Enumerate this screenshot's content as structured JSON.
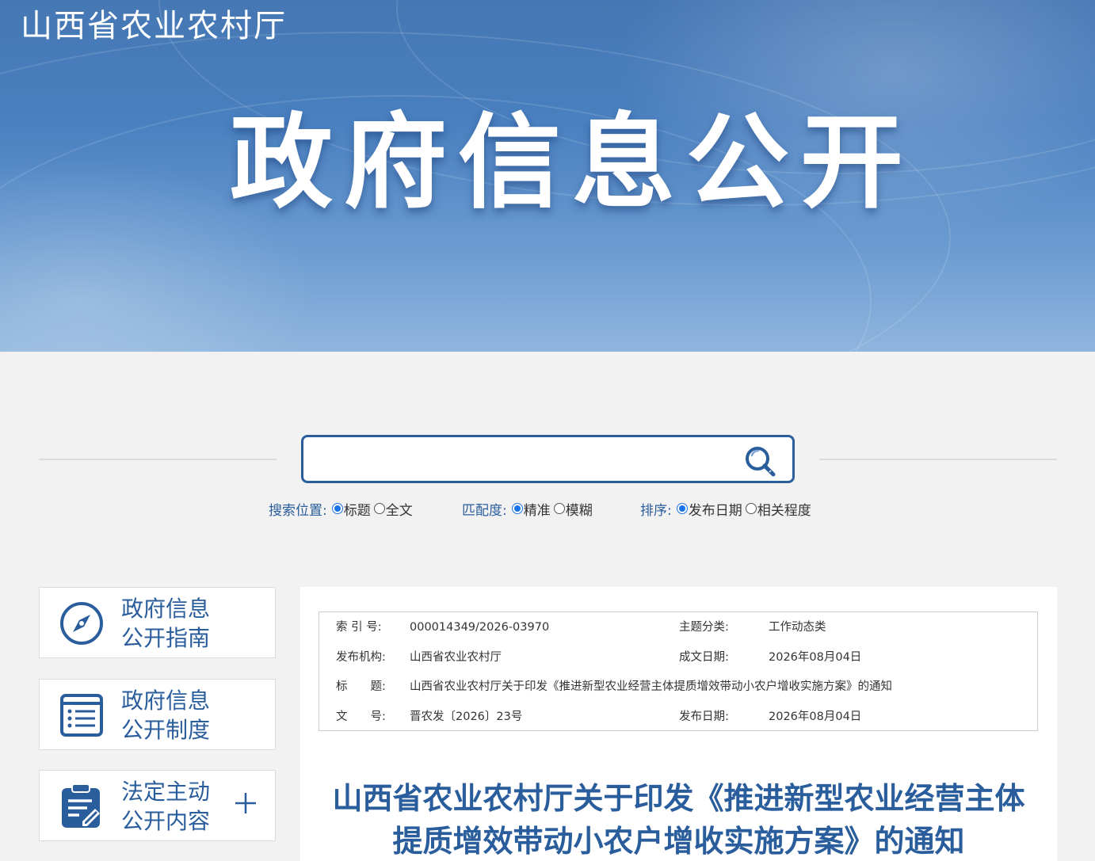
{
  "header": {
    "org_name": "山西省农业农村厅",
    "headline": "政府信息公开"
  },
  "search": {
    "placeholder": "",
    "value": "",
    "button_icon": "search-icon",
    "options": [
      {
        "label": "搜索位置:",
        "choices": [
          {
            "text": "标题",
            "checked": true
          },
          {
            "text": "全文",
            "checked": false
          }
        ]
      },
      {
        "label": "匹配度:",
        "choices": [
          {
            "text": "精准",
            "checked": true
          },
          {
            "text": "模糊",
            "checked": false
          }
        ]
      },
      {
        "label": "排序:",
        "choices": [
          {
            "text": "发布日期",
            "checked": true
          },
          {
            "text": "相关程度",
            "checked": false
          }
        ]
      }
    ]
  },
  "sidebar": {
    "items": [
      {
        "line1": "政府信息",
        "line2": "公开指南",
        "icon": "compass-icon"
      },
      {
        "line1": "政府信息",
        "line2": "公开制度",
        "icon": "document-list-icon"
      },
      {
        "line1": "法定主动",
        "line2": "公开内容",
        "icon": "clipboard-edit-icon",
        "expand_icon": "plus-icon"
      }
    ]
  },
  "meta": {
    "index_label": "索 引 号:",
    "index_value": "000014349/2026-03970",
    "topic_label": "主题分类:",
    "topic_value": "工作动态类",
    "publisher_label": "发布机构:",
    "publisher_value": "山西省农业农村厅",
    "created_label": "成文日期:",
    "created_value": "2026年08月04日",
    "title_label": "标　　题:",
    "title_value": "山西省农业农村厅关于印发《推进新型农业经营主体提质增效带动小农户增收实施方案》的通知",
    "docno_label": "文　　号:",
    "docno_value": "晋农发〔2026〕23号",
    "published_label": "发布日期:",
    "published_value": "2026年08月04日"
  },
  "document": {
    "title_line1": "山西省农业农村厅关于印发《推进新型农业经营主体",
    "title_line2": "提质增效带动小农户增收实施方案》的通知"
  },
  "colors": {
    "brand_blue": "#2a5d9c",
    "radio_blue": "#1a73e8",
    "banner_blue": "#4577b3"
  }
}
